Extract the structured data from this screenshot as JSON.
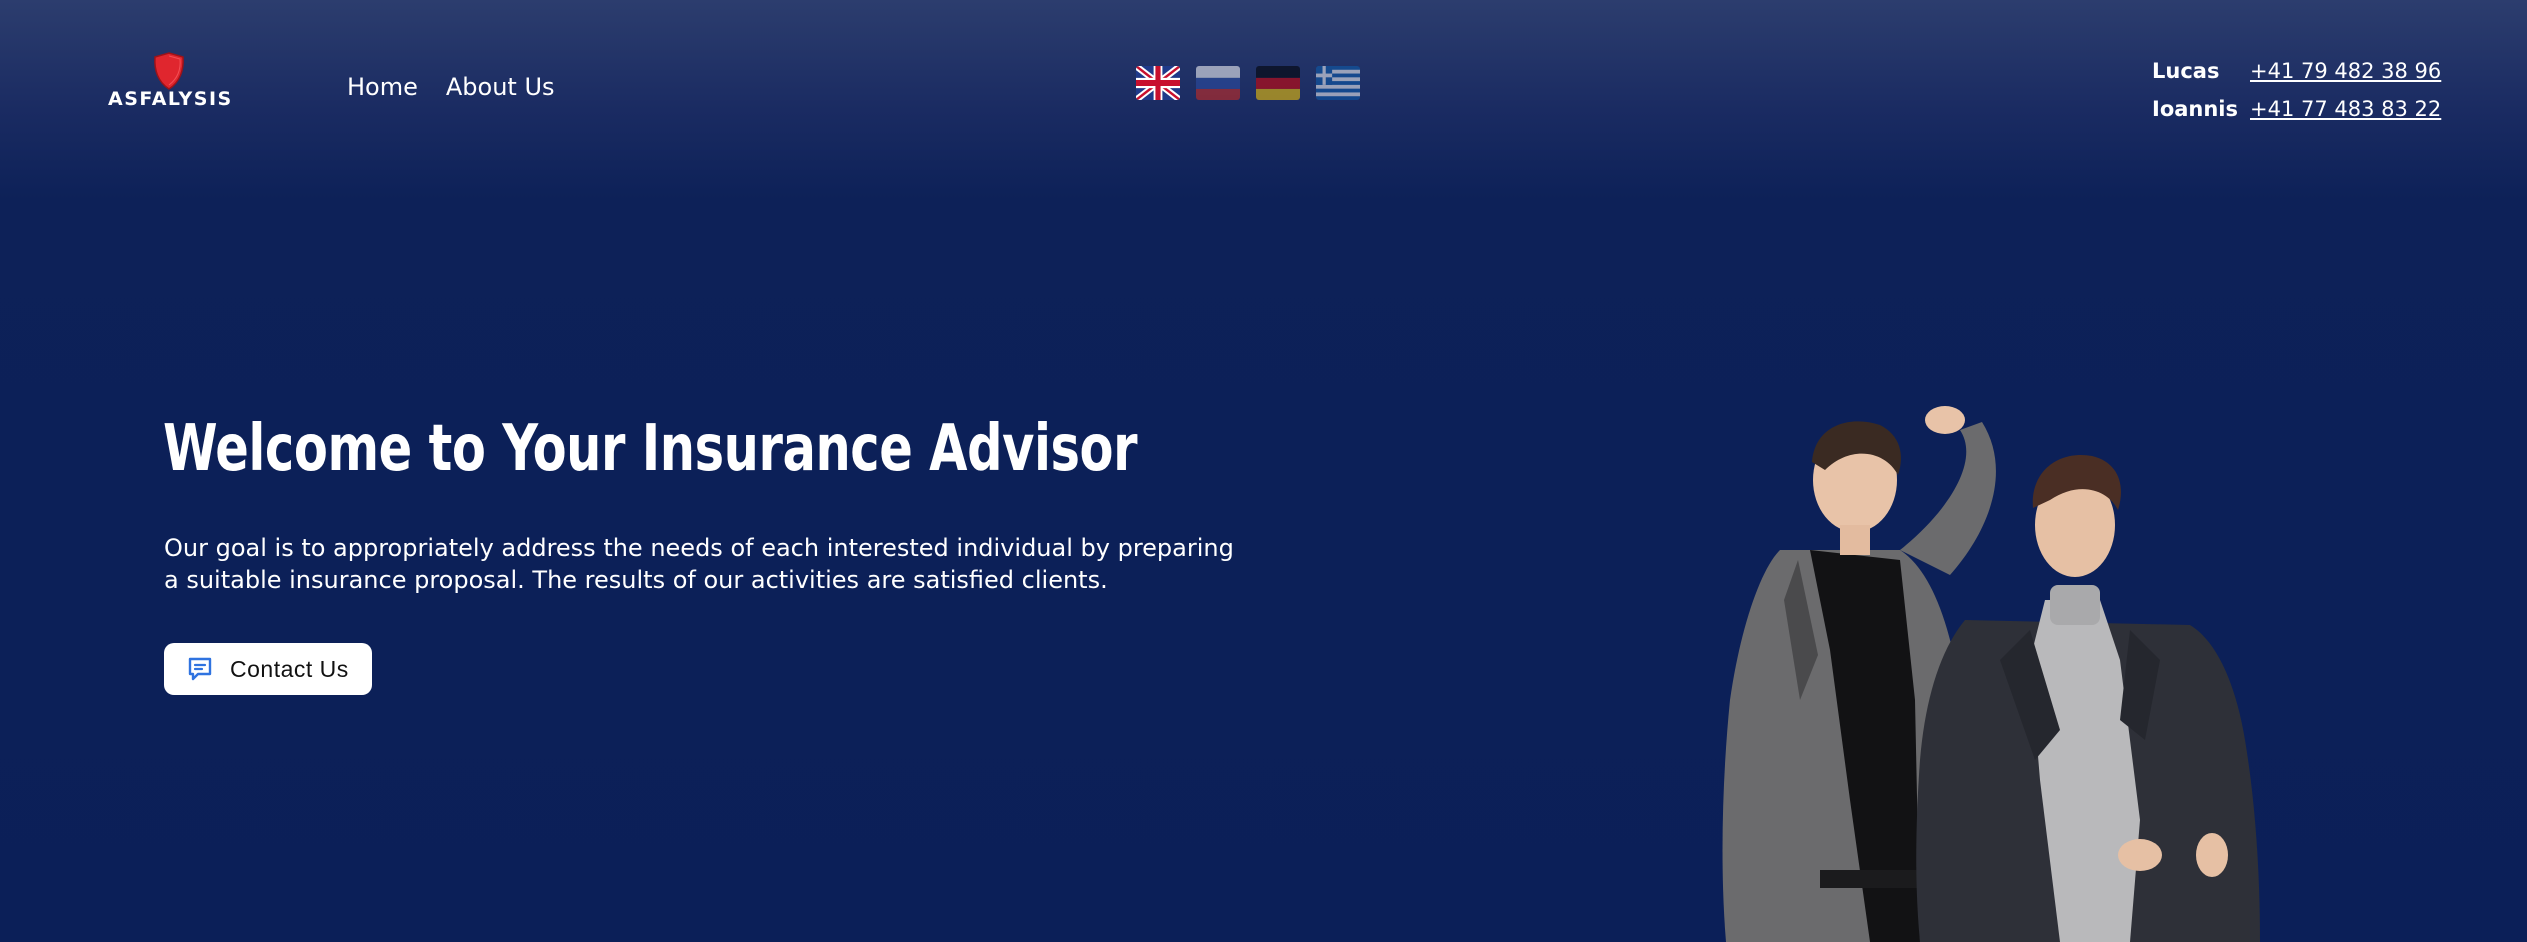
{
  "brand": {
    "name": "ASFALYSIS",
    "colors": {
      "shield": "#e0262e",
      "background": "#0b1f58"
    }
  },
  "nav": {
    "items": [
      {
        "label": "Home"
      },
      {
        "label": "About Us"
      }
    ]
  },
  "languages": [
    {
      "code": "en",
      "icon": "uk-flag-icon",
      "active": true
    },
    {
      "code": "ru",
      "icon": "russia-flag-icon",
      "active": false
    },
    {
      "code": "de",
      "icon": "germany-flag-icon",
      "active": false
    },
    {
      "code": "gr",
      "icon": "greece-flag-icon",
      "active": false
    }
  ],
  "contacts": [
    {
      "name": "Lucas",
      "phone": "+41 79 482 38 96"
    },
    {
      "name": "Ioannis",
      "phone": "+41 77 483 83 22"
    }
  ],
  "hero": {
    "title": "Welcome to Your Insurance Advisor",
    "description": "Our goal is to appropriately address the needs of each interested individual by preparing a suitable insurance proposal. The results of our activities are satisfied clients.",
    "cta_label": "Contact Us",
    "cta_icon": "chat-icon"
  }
}
